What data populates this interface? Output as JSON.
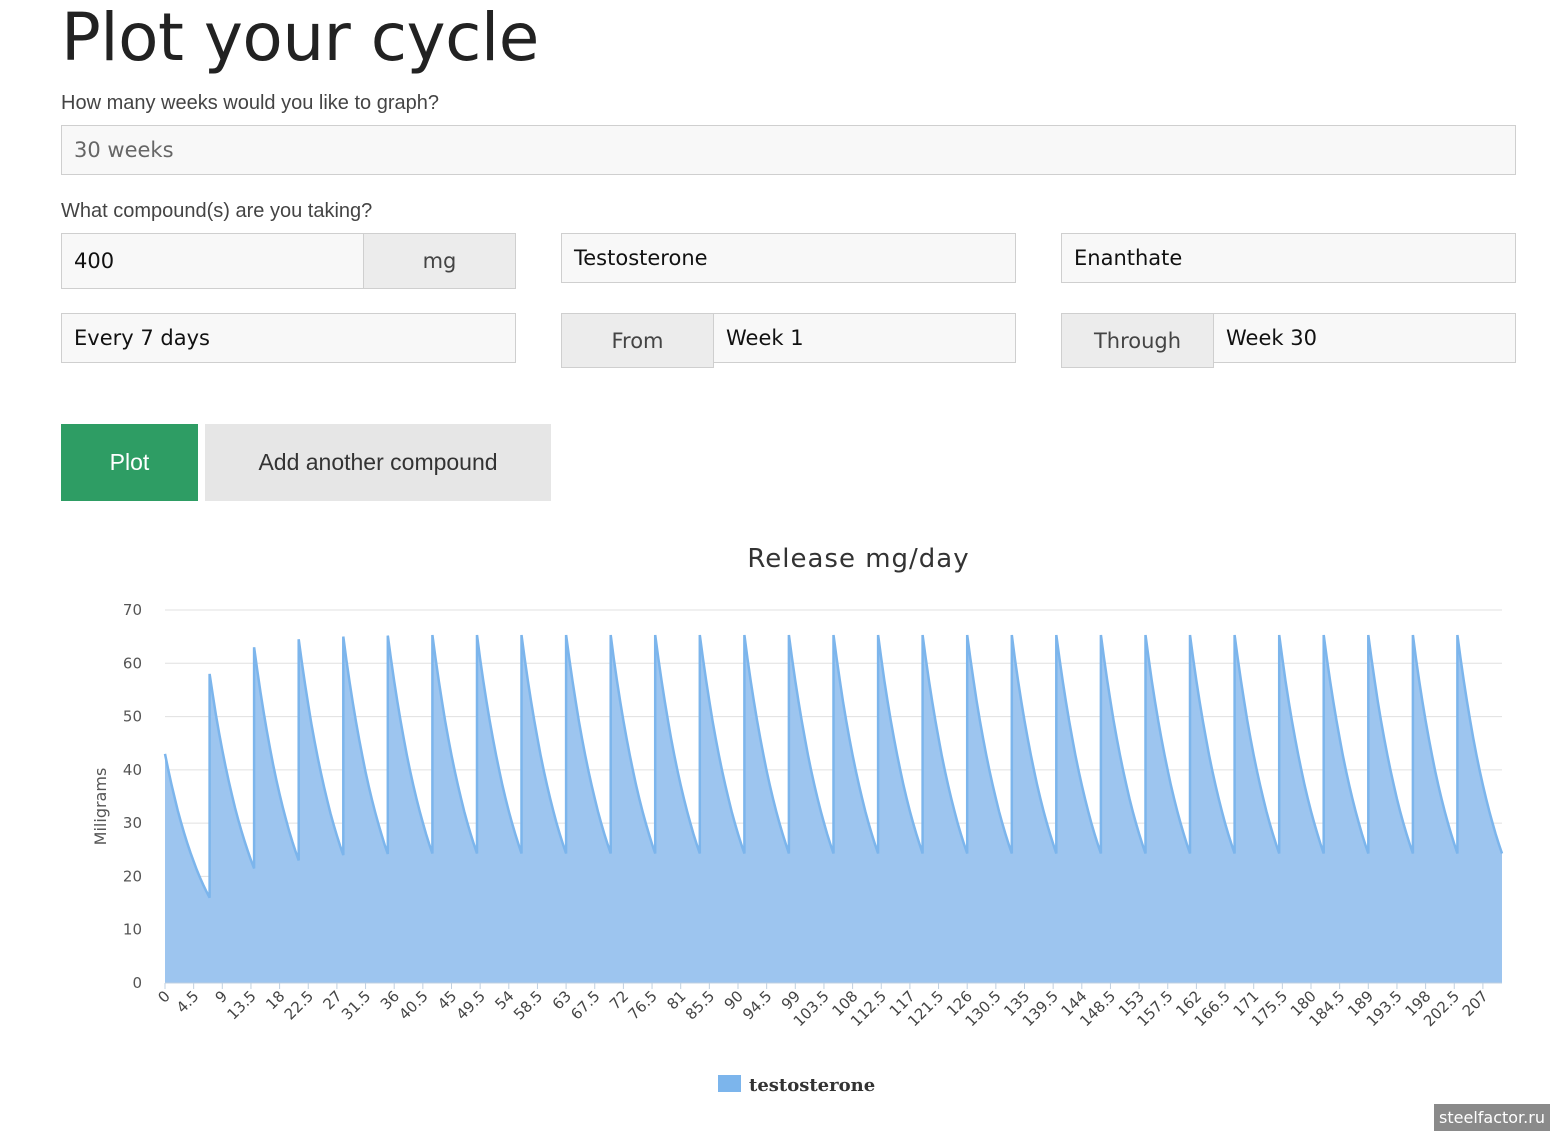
{
  "page": {
    "title": "Plot your cycle",
    "weeks_question": "How many weeks would you like to graph?",
    "weeks_value": "30 weeks",
    "compound_question": "What compound(s) are you taking?"
  },
  "compound": {
    "dose": "400",
    "unit": "mg",
    "name": "Testosterone",
    "ester": "Enanthate",
    "frequency": "Every 7 days",
    "from_label": "From",
    "from_value": "Week 1",
    "through_label": "Through",
    "through_value": "Week 30"
  },
  "buttons": {
    "plot": "Plot",
    "add": "Add another compound"
  },
  "watermark": "steelfactor.ru",
  "colors": {
    "plot_button": "#2e9d64",
    "series_fill": "#9dc5ef",
    "series_line": "#7cb5ec"
  },
  "chart_data": {
    "type": "area",
    "title": "Release mg/day",
    "ylabel": "Miligrams",
    "xlabel": "",
    "ylim": [
      0,
      70
    ],
    "yticks": [
      0,
      10,
      20,
      30,
      40,
      50,
      60,
      70
    ],
    "grid": true,
    "legend_position": "bottom-center",
    "xlim": [
      0,
      210
    ],
    "xtick_labels": [
      "0",
      "4.5",
      "9",
      "13.5",
      "18",
      "22.5",
      "27",
      "31.5",
      "36",
      "40.5",
      "45",
      "49.5",
      "54",
      "58.5",
      "63",
      "67.5",
      "72",
      "76.5",
      "81",
      "85.5",
      "90",
      "94.5",
      "99",
      "103.5",
      "108",
      "112.5",
      "117",
      "121.5",
      "126",
      "130.5",
      "135",
      "139.5",
      "144",
      "148.5",
      "153",
      "157.5",
      "162",
      "166.5",
      "171",
      "175.5",
      "180",
      "184.5",
      "189",
      "193.5",
      "198",
      "202.5",
      "207"
    ],
    "series": [
      {
        "name": "testosterone",
        "injection_interval_days": 7,
        "peaks": [
          43,
          58,
          63,
          64.5,
          65,
          65.2,
          65.3,
          65.3,
          65.3,
          65.3,
          65.3,
          65.3,
          65.3,
          65.3,
          65.3,
          65.3,
          65.3,
          65.3,
          65.3,
          65.3,
          65.3,
          65.3,
          65.3,
          65.3,
          65.3,
          65.3,
          65.3,
          65.3,
          65.3,
          65.3
        ],
        "troughs": [
          16,
          21.5,
          23,
          24,
          24.2,
          24.3,
          24.3,
          24.3,
          24.3,
          24.3,
          24.3,
          24.3,
          24.3,
          24.3,
          24.3,
          24.3,
          24.3,
          24.3,
          24.3,
          24.3,
          24.3,
          24.3,
          24.3,
          24.3,
          24.3,
          24.3,
          24.3,
          24.3,
          24.3,
          24.3
        ]
      }
    ]
  }
}
